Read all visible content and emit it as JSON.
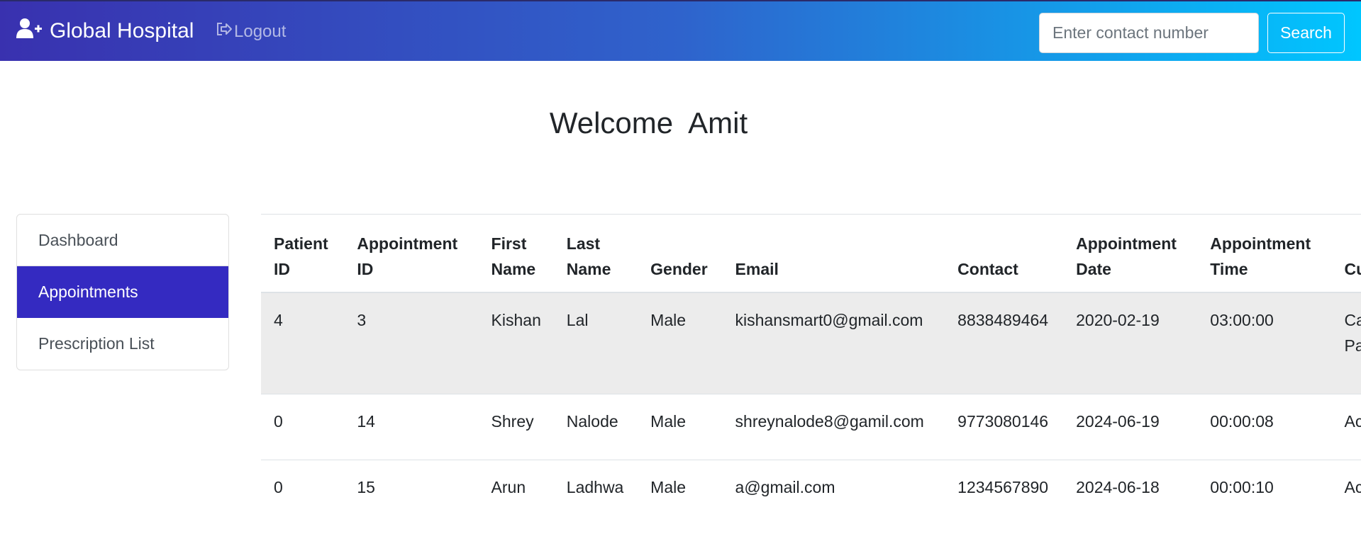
{
  "navbar": {
    "brand_icon": "user-plus-icon",
    "brand": "Global Hospital",
    "logout_icon": "sign-out-icon",
    "logout_label": "Logout",
    "search_placeholder": "Enter contact number",
    "search_value": "",
    "search_button": "Search",
    "gradient_colors": [
      "#3931af",
      "#00c6ff"
    ]
  },
  "welcome": "Welcome  Amit",
  "sidebar": {
    "items": [
      {
        "label": "Dashboard",
        "active": false
      },
      {
        "label": "Appointments",
        "active": true
      },
      {
        "label": "Prescription List",
        "active": false
      }
    ],
    "active_color": "#342ac1"
  },
  "table": {
    "headers": [
      "Patient ID",
      "Appointment ID",
      "First Name",
      "Last Name",
      "Gender",
      "Email",
      "Contact",
      "Appointment Date",
      "Appointment Time",
      "Current Status"
    ],
    "rows": [
      [
        "4",
        "3",
        "Kishan",
        "Lal",
        "Male",
        "kishansmart0@gmail.com",
        "8838489464",
        "2020-02-19",
        "03:00:00",
        "Cancelled by Patient"
      ],
      [
        "0",
        "14",
        "Shrey",
        "Nalode",
        "Male",
        "shreynalode8@gamil.com",
        "9773080146",
        "2024-06-19",
        "00:00:08",
        "Active"
      ],
      [
        "0",
        "15",
        "Arun",
        "Ladhwa",
        "Male",
        "a@gmail.com",
        "1234567890",
        "2024-06-18",
        "00:00:10",
        "Active"
      ]
    ]
  }
}
